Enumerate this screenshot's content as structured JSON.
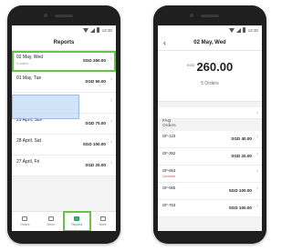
{
  "status_time": "12:30",
  "left": {
    "title": "Reports",
    "days": [
      {
        "date": "02 May, Wed",
        "sub": "5 orders",
        "amount": "SGD 260.00",
        "selected": true
      },
      {
        "date": "01 May, Tue",
        "sub": "",
        "amount": "SGD 50.00",
        "selected": false
      },
      {
        "date": "",
        "sub": "",
        "amount": "",
        "selected": false
      },
      {
        "date": "29 April, Sun",
        "sub": "",
        "amount": "SGD 70.00",
        "selected": false
      },
      {
        "date": "28 April, Sat",
        "sub": "",
        "amount": "SGD 100.00",
        "selected": false
      },
      {
        "date": "27 April, Fri",
        "sub": "",
        "amount": "SGD 20.00",
        "selected": false
      }
    ],
    "nav": [
      {
        "label": "Orders",
        "icon": "orders-icon",
        "active": false
      },
      {
        "label": "Menu",
        "icon": "menu-icon",
        "active": false
      },
      {
        "label": "Reports",
        "icon": "reports-icon",
        "active": true
      },
      {
        "label": "More",
        "icon": "more-icon",
        "active": false
      }
    ]
  },
  "right": {
    "title": "02 May, Wed",
    "currency": "SGD",
    "amount": "260.00",
    "orders_label": "5 Orders",
    "faq_label": "FAQ",
    "orders_section": "Orders",
    "orders": [
      {
        "id": "GF-123",
        "status": "",
        "amount": "SGD 40.00",
        "cancelled": false
      },
      {
        "id": "GF-352",
        "status": "",
        "amount": "SGD 20.00",
        "cancelled": false
      },
      {
        "id": "GF-653",
        "status": "Cancelled",
        "amount": "",
        "cancelled": true
      },
      {
        "id": "GF-065",
        "status": "",
        "amount": "SGD 100.00",
        "cancelled": false
      },
      {
        "id": "GF-753",
        "status": "",
        "amount": "SGD 100.00",
        "cancelled": false
      }
    ]
  },
  "colors": {
    "highlight": "#6cc04a",
    "cancelled": "#e05252",
    "active_nav": "#3cb371",
    "overlay": "#c6dcf5"
  }
}
